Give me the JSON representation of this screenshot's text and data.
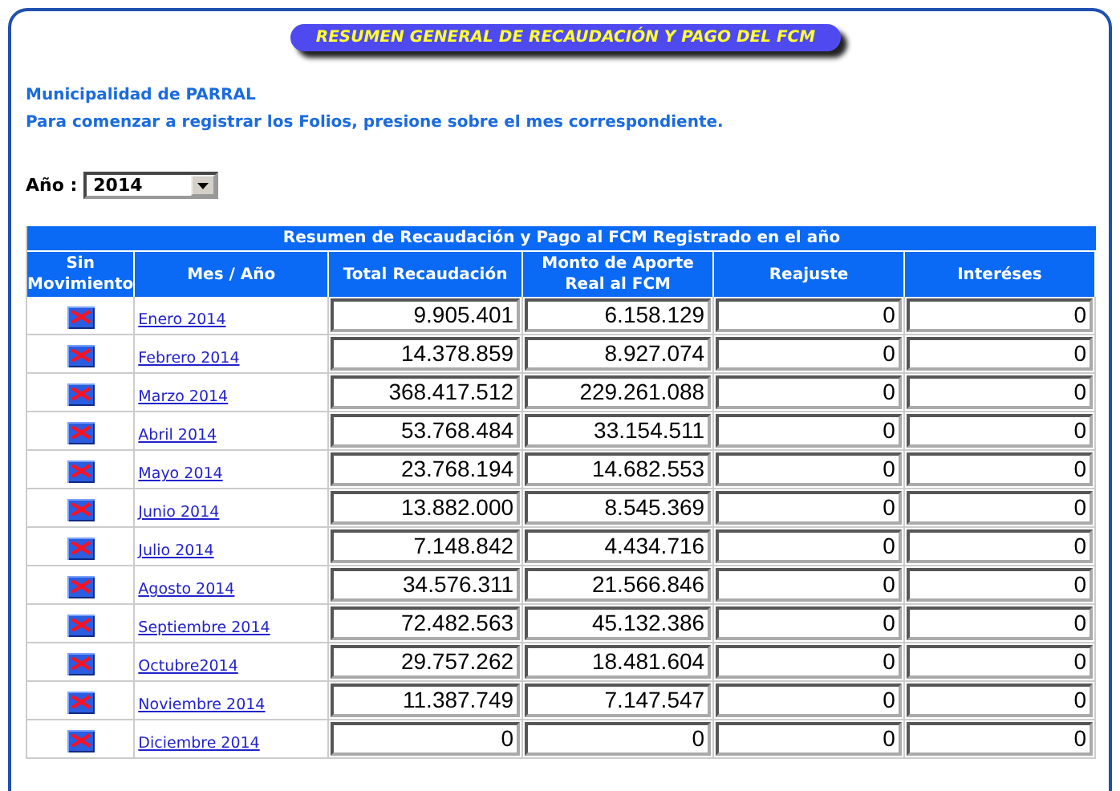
{
  "banner": "RESUMEN GENERAL DE RECAUDACIÓN Y PAGO DEL FCM",
  "municipality": "Municipalidad de PARRAL",
  "instructions": "Para comenzar a registrar los Folios, presione sobre el mes correspondiente.",
  "year_field": {
    "label": "Año :",
    "value": "2014"
  },
  "table": {
    "title": "Resumen de Recaudación y Pago al FCM Registrado en el año",
    "columns": [
      "Sin Movimiento",
      "Mes / Año",
      "Total Recaudación",
      "Monto de Aporte Real al FCM",
      "Reajuste",
      "Interéses"
    ],
    "rows": [
      {
        "month": "Enero 2014",
        "total": "9.905.401",
        "aporte": "6.158.129",
        "reajuste": "0",
        "intereses": "0"
      },
      {
        "month": "Febrero 2014",
        "total": "14.378.859",
        "aporte": "8.927.074",
        "reajuste": "0",
        "intereses": "0"
      },
      {
        "month": "Marzo 2014",
        "total": "368.417.512",
        "aporte": "229.261.088",
        "reajuste": "0",
        "intereses": "0"
      },
      {
        "month": "Abril 2014",
        "total": "53.768.484",
        "aporte": "33.154.511",
        "reajuste": "0",
        "intereses": "0"
      },
      {
        "month": "Mayo 2014",
        "total": "23.768.194",
        "aporte": "14.682.553",
        "reajuste": "0",
        "intereses": "0"
      },
      {
        "month": "Junio 2014",
        "total": "13.882.000",
        "aporte": "8.545.369",
        "reajuste": "0",
        "intereses": "0"
      },
      {
        "month": "Julio 2014",
        "total": "7.148.842",
        "aporte": "4.434.716",
        "reajuste": "0",
        "intereses": "0"
      },
      {
        "month": "Agosto 2014",
        "total": "34.576.311",
        "aporte": "21.566.846",
        "reajuste": "0",
        "intereses": "0"
      },
      {
        "month": "Septiembre 2014",
        "total": "72.482.563",
        "aporte": "45.132.386",
        "reajuste": "0",
        "intereses": "0"
      },
      {
        "month": "Octubre2014",
        "total": "29.757.262",
        "aporte": "18.481.604",
        "reajuste": "0",
        "intereses": "0"
      },
      {
        "month": "Noviembre 2014",
        "total": "11.387.749",
        "aporte": "7.147.547",
        "reajuste": "0",
        "intereses": "0"
      },
      {
        "month": "Diciembre 2014",
        "total": "0",
        "aporte": "0",
        "reajuste": "0",
        "intereses": "0"
      }
    ]
  }
}
